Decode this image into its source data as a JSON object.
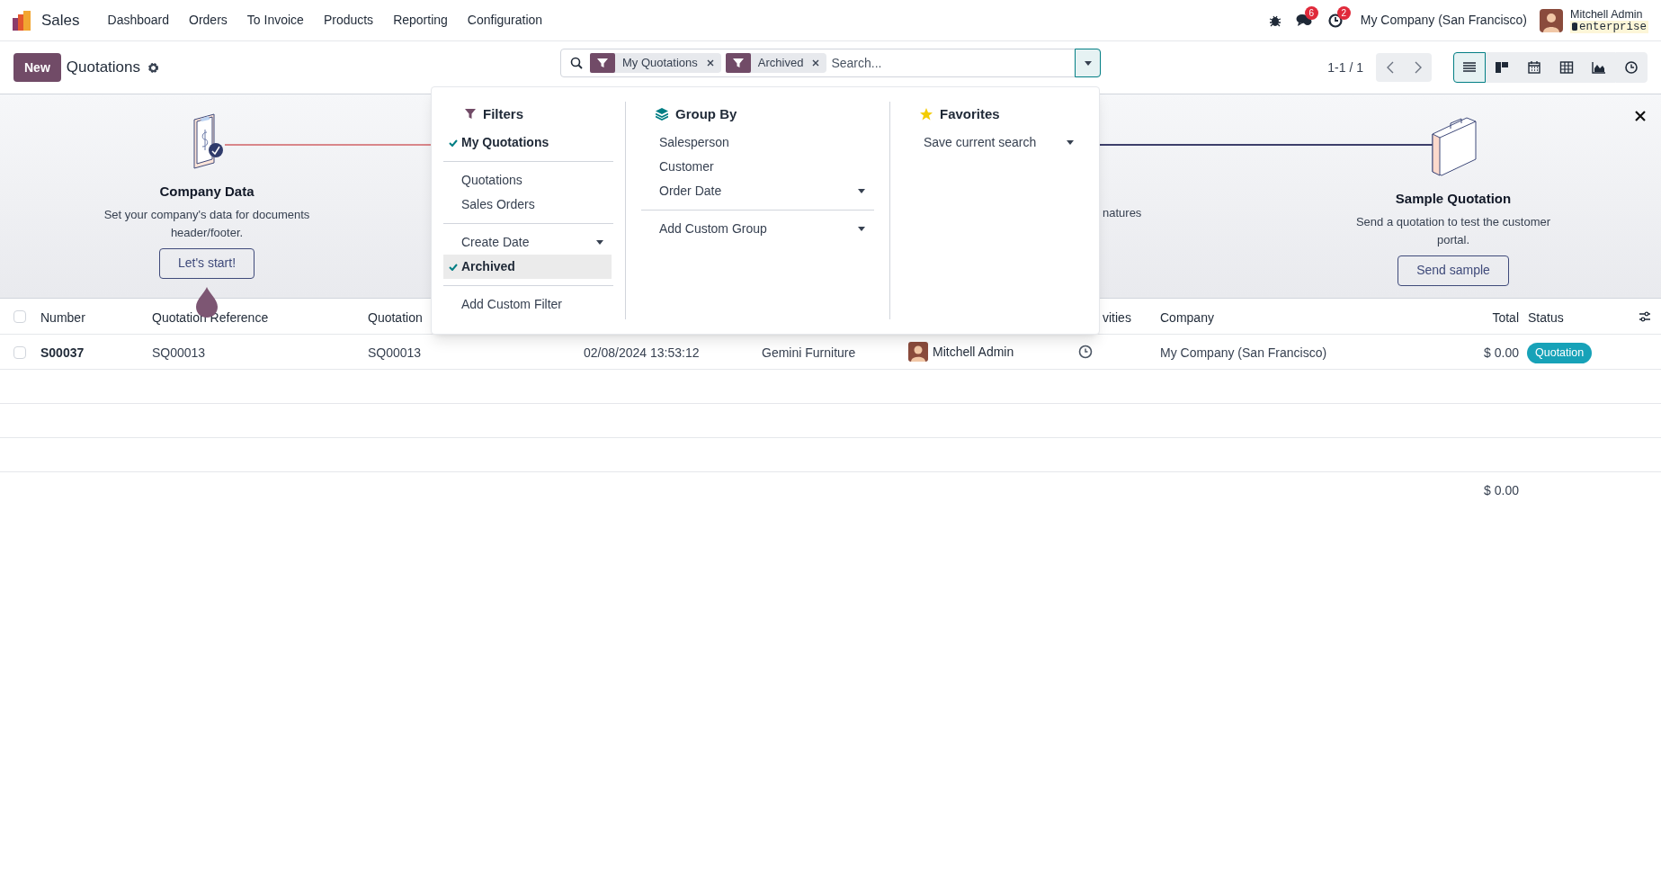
{
  "app": {
    "name": "Sales"
  },
  "menu": [
    "Dashboard",
    "Orders",
    "To Invoice",
    "Products",
    "Reporting",
    "Configuration"
  ],
  "systray": {
    "chat_count": "6",
    "activity_count": "2",
    "company": "My Company (San Francisco)",
    "user": "Mitchell Admin",
    "database": "enterprise"
  },
  "control_panel": {
    "new_button": "New",
    "title": "Quotations"
  },
  "search": {
    "facets": [
      {
        "label": "My Quotations"
      },
      {
        "label": "Archived"
      }
    ],
    "placeholder": "Search..."
  },
  "pager": "1-1 / 1",
  "views": [
    {
      "kind": "list",
      "selected": true
    },
    {
      "kind": "kanban",
      "selected": false
    },
    {
      "kind": "calendar",
      "selected": false
    },
    {
      "kind": "pivot",
      "selected": false
    },
    {
      "kind": "graph",
      "selected": false
    },
    {
      "kind": "activity",
      "selected": false
    }
  ],
  "onboarding": {
    "steps": [
      {
        "kind": "clipboard",
        "title": "Company Data",
        "text": "Set your company's data for documents header/footer.",
        "button": "Let's start!",
        "done": true
      },
      {
        "kind": "briefcase",
        "title": "Sample Quotation",
        "text": "Send a quotation to test the customer portal.",
        "button": "Send sample",
        "done": false
      }
    ],
    "fragment": "natures"
  },
  "dropdown": {
    "filters": {
      "title": "Filters",
      "sections": [
        {
          "items": [
            {
              "label": "My Quotations",
              "checked": true,
              "highlighted": false,
              "submenu": false
            }
          ]
        },
        {
          "items": [
            {
              "label": "Quotations",
              "checked": false,
              "highlighted": false,
              "submenu": false
            },
            {
              "label": "Sales Orders",
              "checked": false,
              "highlighted": false,
              "submenu": false
            }
          ]
        },
        {
          "items": [
            {
              "label": "Create Date",
              "checked": false,
              "highlighted": false,
              "submenu": true
            },
            {
              "label": "Archived",
              "checked": true,
              "highlighted": true,
              "submenu": false
            }
          ]
        },
        {
          "items": [
            {
              "label": "Add Custom Filter",
              "checked": false,
              "highlighted": false,
              "submenu": false
            }
          ]
        }
      ]
    },
    "group_by": {
      "title": "Group By",
      "sections": [
        {
          "items": [
            {
              "label": "Salesperson",
              "submenu": false
            },
            {
              "label": "Customer",
              "submenu": false
            },
            {
              "label": "Order Date",
              "submenu": true
            }
          ]
        },
        {
          "items": [
            {
              "label": "Add Custom Group",
              "submenu": true
            }
          ]
        }
      ]
    },
    "favorites": {
      "title": "Favorites",
      "items": [
        {
          "label": "Save current search",
          "submenu": true
        }
      ]
    }
  },
  "table": {
    "columns": [
      {
        "label": "Number"
      },
      {
        "label": "Quotation Reference"
      },
      {
        "label": "Quotation"
      },
      {},
      {},
      {},
      {
        "label": "vities"
      },
      {
        "label": "Company"
      },
      {
        "label": "Total"
      },
      {
        "label": "Status"
      }
    ],
    "header_checked": false,
    "rows": [
      {
        "selected": false,
        "number": "S00037",
        "reference": "SQ00013",
        "quotation": "SQ00013",
        "date": "02/08/2024 13:53:12",
        "customer": "Gemini Furniture",
        "salesperson": "Mitchell Admin",
        "company": "My Company (San Francisco)",
        "total": "$ 0.00",
        "status": "Quotation"
      }
    ],
    "footer_total": "$ 0.00"
  }
}
